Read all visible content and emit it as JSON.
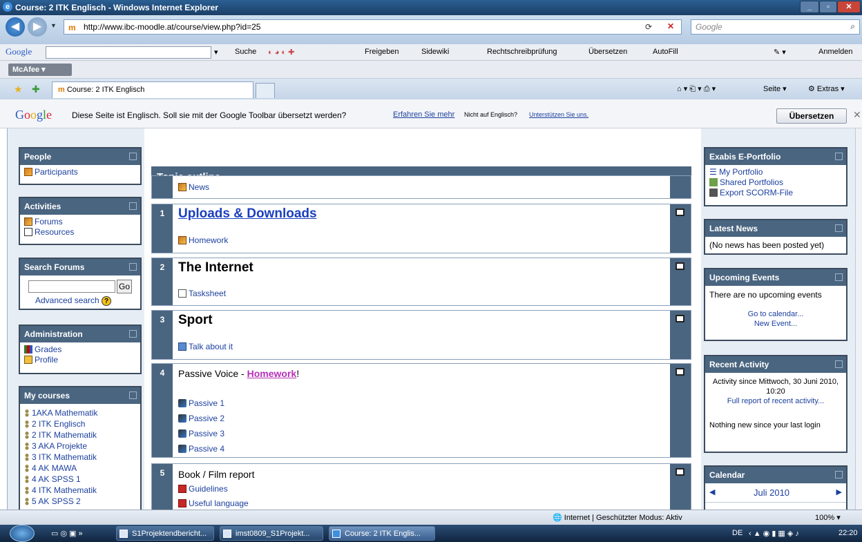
{
  "window": {
    "title": "Course: 2 ITK Englisch - Windows Internet Explorer"
  },
  "address": {
    "url": "http://www.ibc-moodle.at/course/view.php?id=25",
    "search_placeholder": "Google"
  },
  "google_toolbar": {
    "logo": "Google",
    "items": [
      "Suche",
      "Freigeben",
      "Sidewiki",
      "Rechtschreibprüfung",
      "Übersetzen",
      "AutoFill"
    ],
    "signin": "Anmelden"
  },
  "mcafee": {
    "label": "McAfee"
  },
  "tab": {
    "title": "Course: 2 ITK Englisch",
    "tools": [
      "Seite",
      "Extras"
    ]
  },
  "translate": {
    "logo": "Google",
    "message": "Diese Seite ist Englisch. Soll sie mit der Google Toolbar übersetzt werden?",
    "learn_more": "Erfahren Sie mehr",
    "not_english": "Nicht auf Englisch?",
    "support": "Unterstützen Sie uns.",
    "button": "Übersetzen"
  },
  "left": {
    "people": {
      "title": "People",
      "items": [
        "Participants"
      ]
    },
    "activities": {
      "title": "Activities",
      "items": [
        "Forums",
        "Resources"
      ]
    },
    "search": {
      "title": "Search Forums",
      "go": "Go",
      "advanced": "Advanced search"
    },
    "admin": {
      "title": "Administration",
      "items": [
        "Grades",
        "Profile"
      ]
    },
    "courses": {
      "title": "My courses",
      "items": [
        "1AKA Mathematik",
        "2 ITK Englisch",
        "2 ITK Mathematik",
        "3 AKA Projekte",
        "3 ITK Mathematik",
        "4 AK MAWA",
        "4 AK SPSS 1",
        "4 ITK Mathematik",
        "5 AK SPSS 2"
      ]
    }
  },
  "center": {
    "heading": "Topic outline",
    "news": "News",
    "sections": [
      {
        "num": "1",
        "title": "Uploads & Downloads",
        "items": [
          "Homework"
        ]
      },
      {
        "num": "2",
        "title": "The Internet",
        "items": [
          "Tasksheet"
        ]
      },
      {
        "num": "3",
        "title": "Sport",
        "items": [
          "Talk about it"
        ]
      },
      {
        "num": "4",
        "title_prefix": "Passive Voice - ",
        "title_link": "Homework",
        "title_suffix": "!",
        "items": [
          "Passive 1",
          "Passive 2",
          "Passive 3",
          "Passive 4"
        ]
      },
      {
        "num": "5",
        "title": "Book / Film report",
        "items": [
          "Guidelines",
          "Useful language"
        ]
      }
    ]
  },
  "right": {
    "portfolio": {
      "title": "Exabis E-Portfolio",
      "items": [
        "My Portfolio",
        "Shared Portfolios",
        "Export SCORM-File"
      ]
    },
    "news": {
      "title": "Latest News",
      "text": "(No news has been posted yet)"
    },
    "events": {
      "title": "Upcoming Events",
      "text": "There are no upcoming events",
      "calendar": "Go to calendar...",
      "new_event": "New Event..."
    },
    "activity": {
      "title": "Recent Activity",
      "since": "Activity since Mittwoch, 30 Juni 2010, 10:20",
      "full_report": "Full report of recent activity...",
      "nothing": "Nothing new since your last login"
    },
    "calendar": {
      "title": "Calendar",
      "month": "Juli 2010"
    }
  },
  "status": {
    "zone": "Internet | Geschützter Modus: Aktiv",
    "zoom": "100%"
  },
  "taskbar": {
    "items": [
      "S1Projektendbericht...",
      "imst0809_S1Projekt...",
      "Course: 2 ITK Englis..."
    ],
    "lang": "DE",
    "time": "22:20"
  }
}
